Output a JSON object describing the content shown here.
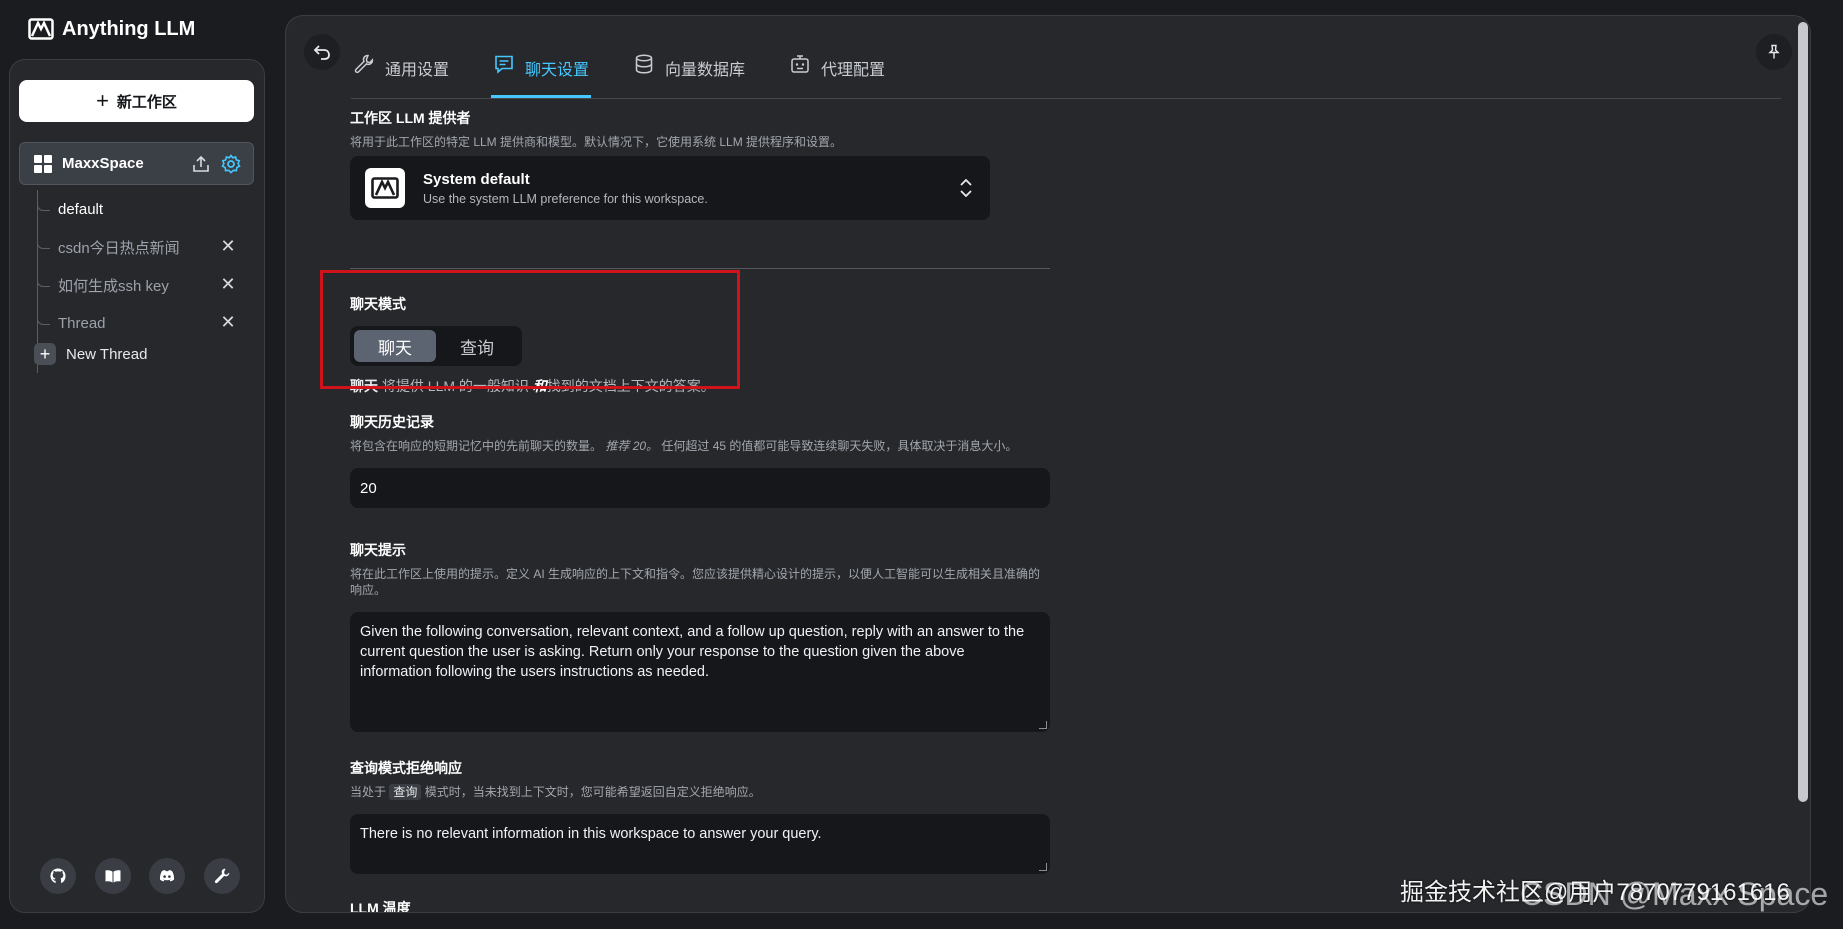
{
  "brand": {
    "name": "Anything LLM"
  },
  "sidebar": {
    "new_workspace": "新工作区",
    "workspace": {
      "name": "MaxxSpace"
    },
    "threads": [
      {
        "label": "default",
        "active": true,
        "closable": false
      },
      {
        "label": "csdn今日热点新闻",
        "active": false,
        "closable": true
      },
      {
        "label": "如何生成ssh key",
        "active": false,
        "closable": true
      },
      {
        "label": "Thread",
        "active": false,
        "closable": true
      }
    ],
    "new_thread": "New Thread",
    "footer_icons": [
      "github-icon",
      "docs-book-icon",
      "discord-icon",
      "wrench-icon"
    ]
  },
  "tabs": [
    {
      "label": "通用设置",
      "icon": "wrench-icon",
      "active": false
    },
    {
      "label": "聊天设置",
      "icon": "chat-icon",
      "active": true
    },
    {
      "label": "向量数据库",
      "icon": "database-icon",
      "active": false
    },
    {
      "label": "代理配置",
      "icon": "robot-icon",
      "active": false
    }
  ],
  "llm_provider": {
    "title": "工作区 LLM 提供者",
    "desc": "将用于此工作区的特定 LLM 提供商和模型。默认情况下，它使用系统 LLM 提供程序和设置。",
    "name": "System default",
    "sub": "Use the system LLM preference for this workspace."
  },
  "chat_mode": {
    "title": "聊天模式",
    "options": [
      "聊天",
      "查询"
    ],
    "selected": "聊天",
    "desc_bold": "聊天",
    "desc_mid": "将提供 LLM 的一般知识",
    "desc_em": "和",
    "desc_end": "找到的文档上下文的答案。"
  },
  "history": {
    "title": "聊天历史记录",
    "desc_start": "将包含在响应的短期记忆中的先前聊天的数量。",
    "desc_em": "推荐 20。",
    "desc_end": "任何超过 45 的值都可能导致连续聊天失败，具体取决于消息大小。",
    "value": "20"
  },
  "prompt": {
    "title": "聊天提示",
    "desc": "将在此工作区上使用的提示。定义 AI 生成响应的上下文和指令。您应该提供精心设计的提示，以便人工智能可以生成相关且准确的响应。",
    "value": "Given the following conversation, relevant context, and a follow up question, reply with an answer to the current question the user is asking. Return only your response to the question given the above information following the users instructions as needed."
  },
  "refusal": {
    "title": "查询模式拒绝响应",
    "desc_start": "当处于",
    "desc_tag": "查询",
    "desc_end": "模式时，当未找到上下文时，您可能希望返回自定义拒绝响应。",
    "value": "There is no relevant information in this workspace to answer your query."
  },
  "temperature": {
    "title": "LLM 温度"
  },
  "watermark": {
    "text": "掘金技术社区@用户7870779161616",
    "text2": "CSDN @Maxx Space"
  },
  "colors": {
    "accent": "#46c8ff",
    "highlight": "#d0121b",
    "bg": "#1b1c1f",
    "panel": "#26282c"
  }
}
